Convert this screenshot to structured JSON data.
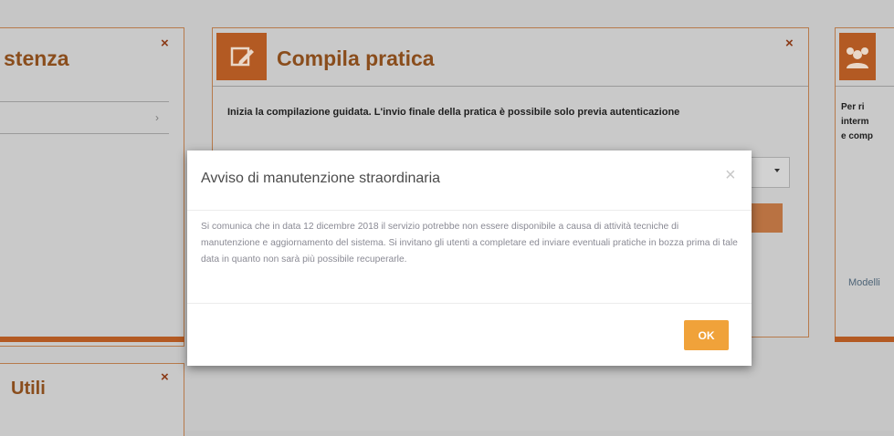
{
  "panels": {
    "left_top": {
      "title": "stenza"
    },
    "center": {
      "title": "Compila pratica",
      "text": "Inizia la compilazione guidata. L'invio finale della pratica è possibile solo previa autenticazione"
    },
    "right": {
      "text_line1": "Per ri",
      "text_line2": "interm",
      "text_line3": "e comp",
      "link": "Modelli"
    },
    "left_bottom": {
      "title": "Utili"
    },
    "close_glyph": "×"
  },
  "modal": {
    "title": "Avviso di manutenzione straordinaria",
    "close_glyph": "×",
    "body": "Si comunica che in data 12 dicembre 2018 il servizio potrebbe non essere disponibile a causa di attività tecniche di manutenzione e aggiornamento del sistema. Si invitano gli utenti a completare ed inviare eventuali pratiche in bozza prima di tale data in quanto non sarà più possibile recuperarle.",
    "ok_label": "OK"
  },
  "colors": {
    "accent": "#f0a23a",
    "panel_orange": "#b35a23",
    "overlay": "#c6c6c6"
  }
}
